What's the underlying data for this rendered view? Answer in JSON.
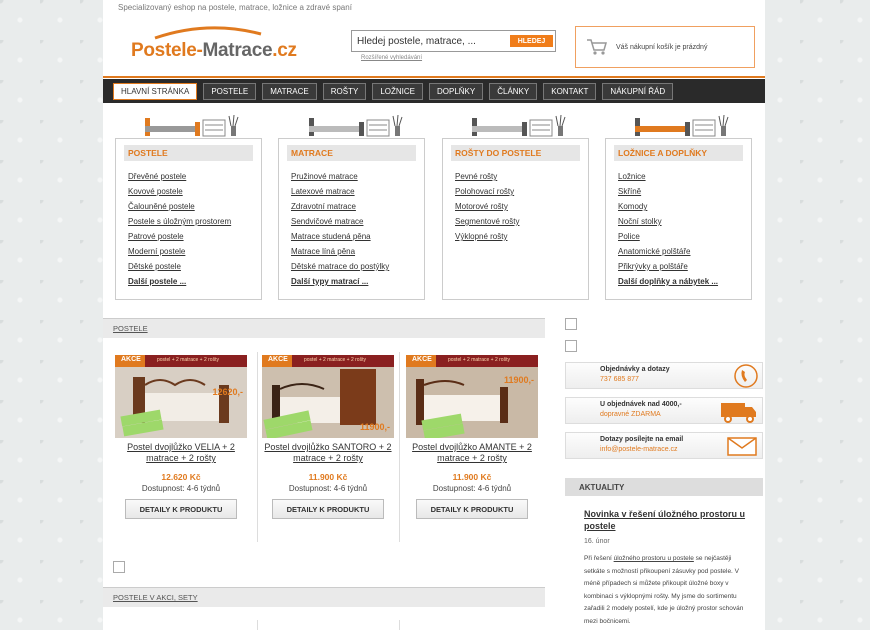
{
  "header": {
    "tagline": "Specializovaný eshop na postele, matrace, ložnice a zdravé spaní",
    "logo_part1": "Postele-",
    "logo_part2": "Matrace",
    "logo_part3": ".cz"
  },
  "search": {
    "value": "Hledej postele, matrace, ...",
    "button_label": "HLEDEJ",
    "advanced_label": "Rozšířené vyhledávání"
  },
  "cart": {
    "text": "Váš nákupní košík je prázdný"
  },
  "nav": {
    "items": [
      "Hlavní stránka",
      "Postele",
      "Matrace",
      "Rošty",
      "Ložnice",
      "Doplňky",
      "Články",
      "Kontakt",
      "Nákupní řád"
    ]
  },
  "categories": [
    {
      "title": "POSTELE",
      "links": [
        "Dřevěné postele",
        "Kovové postele",
        "Čalouněné postele",
        "Postele s úložným prostorem",
        "Patrové postele",
        "Moderní postele",
        "Dětské postele"
      ],
      "more": "Další postele ..."
    },
    {
      "title": "MATRACE",
      "links": [
        "Pružinové matrace",
        "Latexové matrace",
        "Zdravotní matrace",
        "Sendvičové matrace",
        "Matrace studená pěna",
        "Matrace líná pěna",
        "Dětské matrace do postýlky"
      ],
      "more": "Další typy matrací ..."
    },
    {
      "title": "ROŠTY DO POSTELE",
      "links": [
        "Pevné rošty",
        "Polohovací rošty",
        "Motorové rošty",
        "Segmentové rošty",
        "Výklopné rošty"
      ],
      "more": ""
    },
    {
      "title": "LOŽNICE A DOPLŇKY",
      "links": [
        "Ložnice",
        "Skříně",
        "Komody",
        "Noční stolky",
        "Police",
        "Anatomické polštáře",
        "Přikrývky a polštáře"
      ],
      "more": "Další doplňky a nábytek ..."
    }
  ],
  "sections": {
    "postele": "POSTELE",
    "akce": "POSTELE V AKCI, SETY"
  },
  "products": [
    {
      "name": "Postel dvojlůžko VELIA + 2 matrace + 2 rošty",
      "price": "12.620 Kč",
      "availability": "Dostupnost: 4-6 týdnů",
      "button": "DETAILY K PRODUKTU",
      "img_price": "12620,-",
      "badge": "AKCE",
      "banner": "postel + 2 matrace + 2 rošty"
    },
    {
      "name": "Postel dvojlůžko SANTORO + 2 matrace + 2 rošty",
      "price": "11.900 Kč",
      "availability": "Dostupnost: 4-6 týdnů",
      "button": "DETAILY K PRODUKTU",
      "img_price": "11900,-",
      "badge": "AKCE",
      "banner": "postel + 2 matrace + 2 rošty"
    },
    {
      "name": "Postel dvojlůžko AMANTE + 2 matrace + 2 rošty",
      "price": "11.900 Kč",
      "availability": "Dostupnost: 4-6 týdnů",
      "button": "DETAILY K PRODUKTU",
      "img_price": "11900,-",
      "badge": "AKCE",
      "banner": "postel + 2 matrace + 2 rošty"
    }
  ],
  "contact": {
    "orders_label": "Objednávky a dotazy",
    "phone": "737 685 877",
    "shipping_label": "U objednávek nad 4000,-",
    "shipping_value": "dopravné ZDARMA",
    "email_label": "Dotazy posílejte na email",
    "email": "info@postele-matrace.cz"
  },
  "news": {
    "heading": "AKTUALITY",
    "title": "Novinka v řešení úložného prostoru u postele",
    "date": "16. únor",
    "text_before_link": "Při řešení ",
    "link_text": "úložného prostoru u postele",
    "text_after_link": " se nejčastěji setkáte s možností přikoupení zásuvky pod postele. V méně případech si můžete přikoupit úložné boxy v kombinaci s výklopnými rošty. My jsme do sortimentu zařadili 2 modely postelí, kde je úložný prostor schován mezi bočnicemi."
  },
  "colors": {
    "accent": "#e07a1f",
    "nav_bg": "#2a2a2a"
  }
}
